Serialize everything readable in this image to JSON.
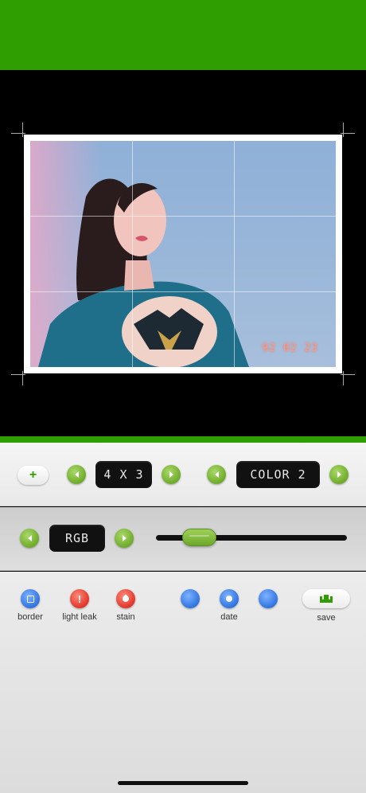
{
  "photo": {
    "date_stamp": "92 02 23"
  },
  "format": {
    "add_label": "+",
    "aspect_value": "4 X 3",
    "color_value": "COLOR 2"
  },
  "effect": {
    "mode_value": "RGB",
    "intensity_fraction": 0.17
  },
  "toolbar": {
    "border_label": "border",
    "light_leak_label": "light leak",
    "light_leak_glyph": "!",
    "stain_label": "stain",
    "date_label": "date",
    "save_label": "save"
  },
  "colors": {
    "brand_green": "#2f9e00",
    "button_green": "#6fab2a",
    "button_blue": "#2f74e0",
    "button_red": "#e0362a"
  }
}
